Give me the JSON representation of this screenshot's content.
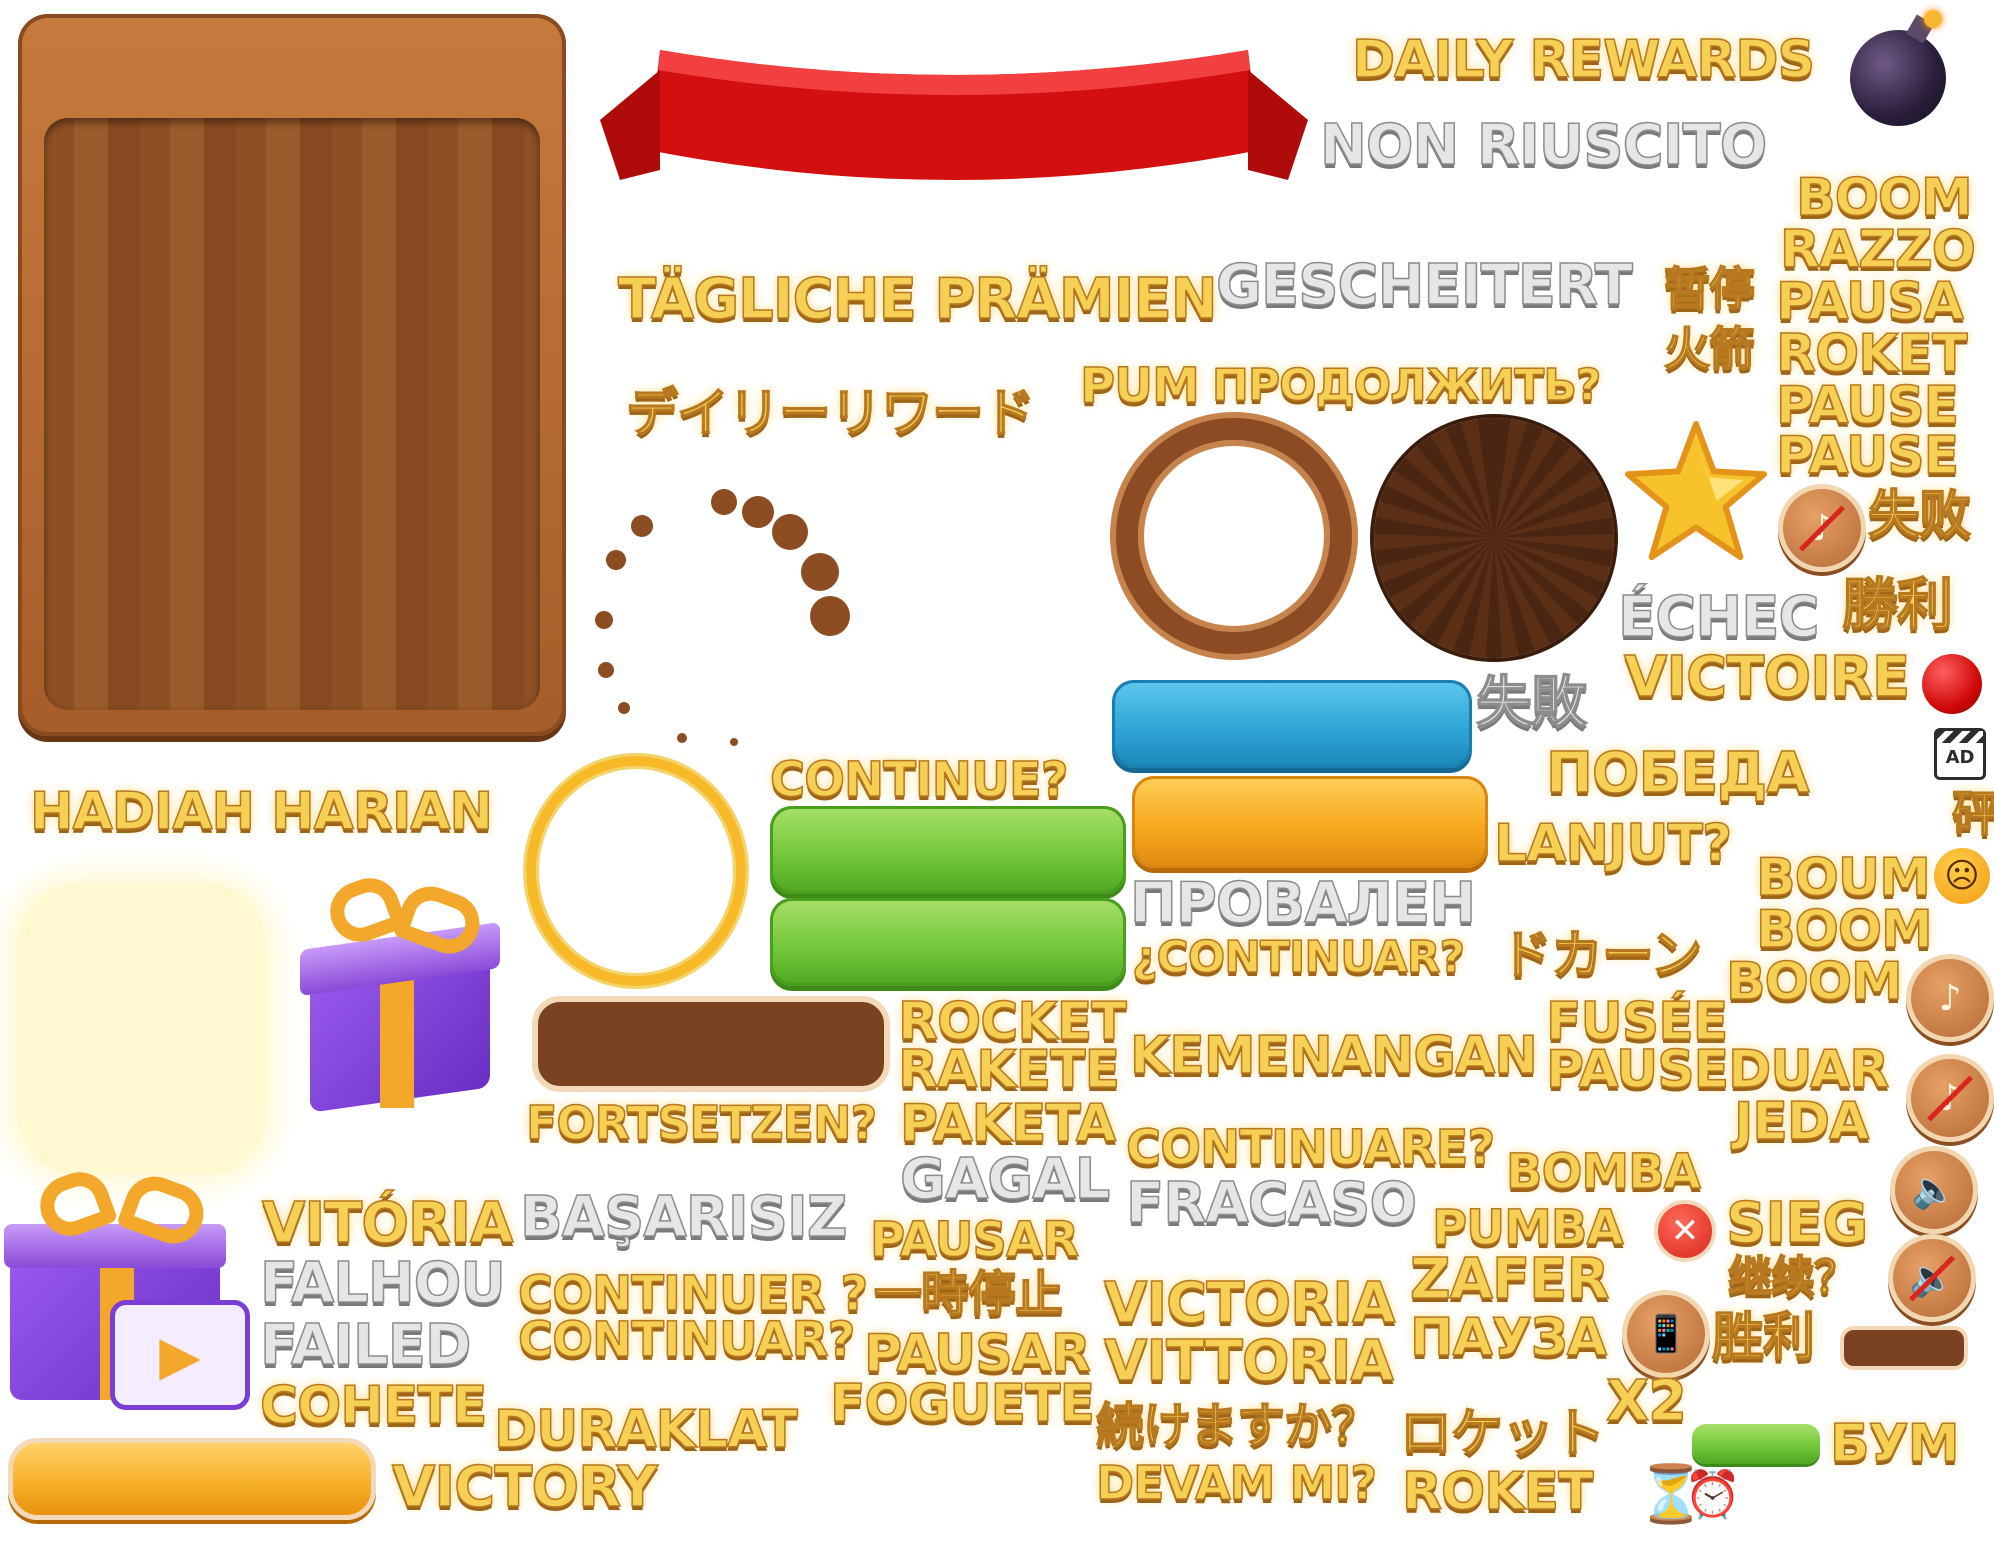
{
  "labels": {
    "daily_rewards": "DAILY REWARDS",
    "non_riuscito": "NON RIUSCITO",
    "boom1": "BOOM",
    "razzo": "RAZZO",
    "pausa1": "PAUSA",
    "roket1": "ROKET",
    "pause1": "PAUSE",
    "pause2": "PAUSE",
    "shibai_zh": "失败",
    "taegliche": "TÄGLICHE PRÄMIEN",
    "gescheitert": "GESCHEITERT",
    "zanting": "暂停",
    "huojian": "火箭",
    "pum": "PUM",
    "prodolzhit": "ПРОДОЛЖИТЬ?",
    "daily_jp": "デイリーリワード",
    "echec": "ÉCHEC",
    "shengli_jp": "勝利",
    "victoire": "VICTOIRE",
    "shippai_jp": "失敗",
    "pobeda": "ПОБЕДА",
    "sui": "砰",
    "hadiah": "HADIAH HARIAN",
    "continue": "CONTINUE?",
    "lanjut": "LANJUT?",
    "boum": "BOUM",
    "boom2": "BOOM",
    "provalen": "ПРОВАЛЕН",
    "continuar_es": "¿CONTINUAR?",
    "dokan": "ドカーン",
    "boom3": "BOOM",
    "rocket": "ROCKET",
    "rakete": "RAKETE",
    "fusee": "FUSÉE",
    "kemenangan": "KEMENANGAN",
    "pause_duar": "PAUSEDUAR",
    "fortsetzen": "FORTSETZEN?",
    "paketa": "PAKETA",
    "jeda": "JEDA",
    "continuare": "CONTINUARE?",
    "gagal": "GAGAL",
    "bomba": "BOMBA",
    "vitoria": "VITÓRIA",
    "basarisiz": "BAŞARISIZ",
    "pausar1": "PAUSAR",
    "fracaso": "FRACASO",
    "pumba": "PUMBA",
    "sieg": "SIEG",
    "falhou": "FALHOU",
    "continuer": "CONTINUER ?",
    "ichiji": "一時停止",
    "victoria": "VICTORIA",
    "zafer": "ZAFER",
    "jixu": "继续？",
    "failed": "FAILED",
    "continuar_pt": "CONTINUAR?",
    "pausar2": "PAUSAR",
    "vittoria": "VITTORIA",
    "pauza": "ПАУЗА",
    "shengli_zh": "胜利",
    "cohete": "COHETE",
    "foguete": "FOGUETE",
    "x2": "X2",
    "duraklat": "DURAKLAT",
    "tsuzuke": "続けますか？",
    "roketto": "ロケット",
    "bum": "БУМ",
    "victory": "VICTORY",
    "devam": "DEVAM MI?",
    "roket2": "ROKET",
    "ad": "AD"
  },
  "icons": {
    "bomb": "bomb-icon",
    "star": "star-icon",
    "music_off": "music-off-icon",
    "record": "record-button-icon",
    "ad": "ad-clapper-icon",
    "sad": "sad-face-icon",
    "music_on": "music-icon",
    "sound_on": "sound-on-icon",
    "close": "close-icon",
    "sound_off": "sound-off-icon",
    "vibrate": "vibrate-icon",
    "hourglass": "hourglass-icon",
    "alarm": "alarm-clock-icon",
    "gift": "gift-icon",
    "gift_video": "gift-video-icon"
  },
  "colors": {
    "gold_text": "#f6cf55",
    "gold_stroke": "#b7781f",
    "silver_text": "#e6e6e6",
    "wood": "#9c5a2c",
    "ribbon": "#d40f0f",
    "green_button": "#74c83a",
    "blue_button": "#2fa6d6",
    "orange_button": "#f7a81e",
    "brown_bar": "#7a4220"
  }
}
